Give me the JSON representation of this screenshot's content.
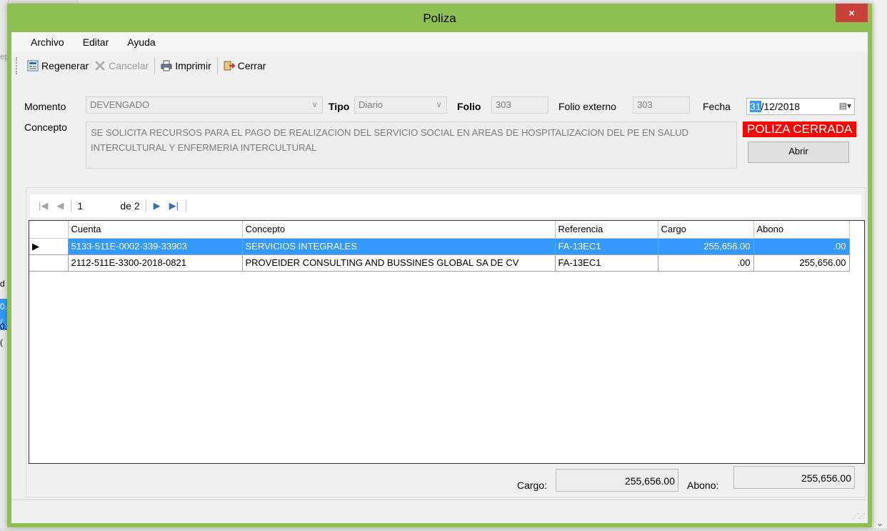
{
  "dialog": {
    "title": "Poliza",
    "close_glyph": "×"
  },
  "menu": [
    "Archivo",
    "Editar",
    "Ayuda"
  ],
  "toolbar": {
    "regenerar": "Regenerar",
    "cancelar": "Cancelar",
    "imprimir": "Imprimir",
    "cerrar": "Cerrar"
  },
  "form": {
    "momento_label": "Momento",
    "momento_value": "DEVENGADO",
    "tipo_label": "Tipo",
    "tipo_value": "Diario",
    "folio_label": "Folio",
    "folio_value": "303",
    "folio_externo_label": "Folio externo",
    "folio_externo_value": "303",
    "fecha_label": "Fecha",
    "fecha_day": "31",
    "fecha_rest": "/12/2018",
    "concepto_label": "Concepto",
    "concepto_value": "SE SOLICITA RECURSOS PARA EL PAGO DE REALIZACION DEL SERVICIO SOCIAL EN AREAS DE HOSPITALIZACION DEL PE EN SALUD INTERCULTURAL Y ENFERMERIA INTERCULTURAL",
    "status_badge": "POLIZA CERRADA",
    "abrir_button": "Abrir"
  },
  "navigator": {
    "current": "1",
    "of_label": "de 2"
  },
  "grid": {
    "columns": [
      "Cuenta",
      "Concepto",
      "Referencia",
      "Cargo",
      "Abono"
    ],
    "rows": [
      {
        "cuenta": "5133-511E-0002-339-33903",
        "concepto": "SERVICIOS INTEGRALES",
        "referencia": "FA-13EC1",
        "cargo": "255,656.00",
        "abono": ".00",
        "selected": true
      },
      {
        "cuenta": "2112-511E-3300-2018-0821",
        "concepto": "PROVEIDER CONSULTING AND BUSSINES GLOBAL SA DE CV",
        "referencia": "FA-13EC1",
        "cargo": ".00",
        "abono": "255,656.00",
        "selected": false
      }
    ]
  },
  "totals": {
    "cargo_label": "Cargo:",
    "cargo_value": "255,656.00",
    "abono_label": "Abono:",
    "abono_value": "255,656.00"
  },
  "background": {
    "top_text": "0",
    "cells": [
      "ep",
      "d",
      "0.(",
      "0.("
    ]
  },
  "colors": {
    "title_bar": "#8cc152",
    "selection": "#3399ff",
    "status_badge": "#ff0000",
    "close_button": "#c7413a"
  }
}
